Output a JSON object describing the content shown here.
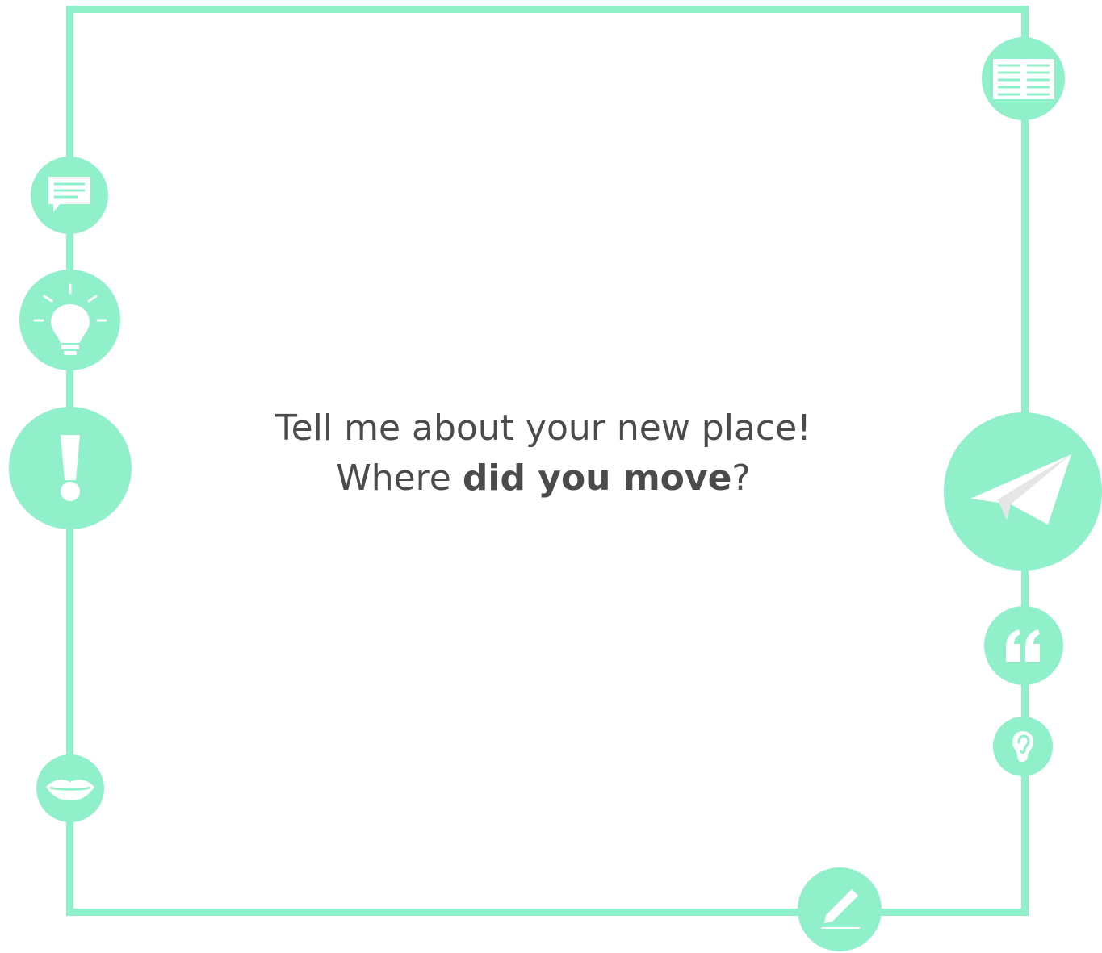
{
  "prompt": {
    "line1": "Tell me about your new place!",
    "line2_before": "Where ",
    "line2_bold": "did you move",
    "line2_after": "?"
  },
  "colors": {
    "accent": "#8ff0c9",
    "text": "#4b4b4b",
    "background": "#ffffff"
  },
  "icons": [
    "newspaper-icon",
    "speech-bubble-icon",
    "lightbulb-icon",
    "exclamation-icon",
    "paper-plane-icon",
    "quote-icon",
    "ear-icon",
    "lips-icon",
    "pencil-icon"
  ]
}
